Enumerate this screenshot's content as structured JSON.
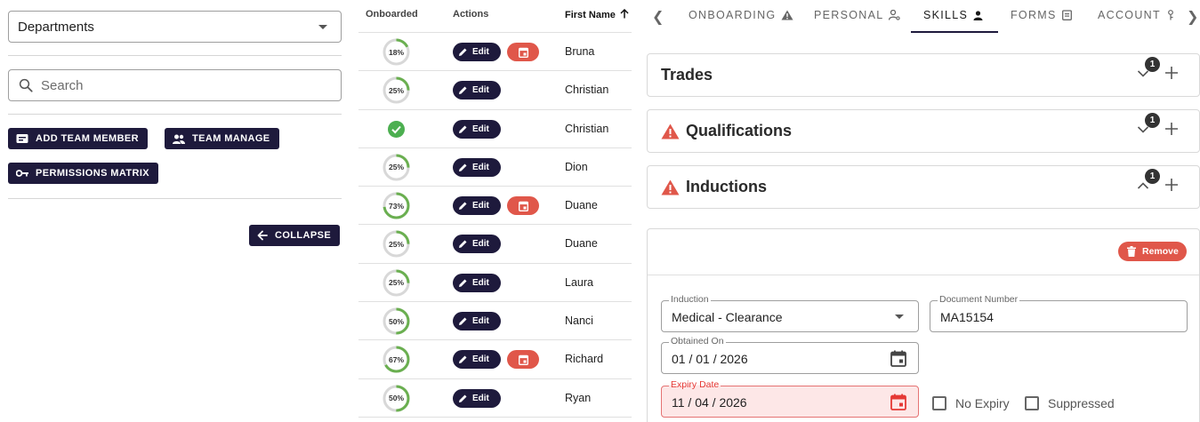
{
  "left": {
    "departments_value": "Departments",
    "search_placeholder": "Search",
    "buttons": {
      "add_team_member": "ADD TEAM MEMBER",
      "team_manage": "TEAM MANAGE",
      "permissions_matrix": "PERMISSIONS MATRIX",
      "collapse": "COLLAPSE"
    }
  },
  "table": {
    "headers": {
      "onboarded": "Onboarded",
      "actions": "Actions",
      "first_name": "First Name"
    },
    "edit_label": "Edit",
    "rows": [
      {
        "progress": 18,
        "label": "18%",
        "first_name": "Bruna",
        "calendar": true
      },
      {
        "progress": 25,
        "label": "25%",
        "first_name": "Christian",
        "calendar": false
      },
      {
        "progress": 100,
        "label": "",
        "first_name": "Christian",
        "calendar": false,
        "complete": true
      },
      {
        "progress": 25,
        "label": "25%",
        "first_name": "Dion",
        "calendar": false
      },
      {
        "progress": 73,
        "label": "73%",
        "first_name": "Duane",
        "calendar": true
      },
      {
        "progress": 25,
        "label": "25%",
        "first_name": "Duane",
        "calendar": false
      },
      {
        "progress": 25,
        "label": "25%",
        "first_name": "Laura",
        "calendar": false
      },
      {
        "progress": 50,
        "label": "50%",
        "first_name": "Nanci",
        "calendar": false
      },
      {
        "progress": 67,
        "label": "67%",
        "first_name": "Richard",
        "calendar": true
      },
      {
        "progress": 50,
        "label": "50%",
        "first_name": "Ryan",
        "calendar": false
      }
    ]
  },
  "tabs": {
    "onboarding": "ONBOARDING",
    "personal": "PERSONAL",
    "skills": "SKILLS",
    "forms": "FORMS",
    "account": "ACCOUNT"
  },
  "panels": {
    "trades": {
      "title": "Trades",
      "count": "1"
    },
    "qualifications": {
      "title": "Qualifications",
      "count": "1"
    },
    "inductions": {
      "title": "Inductions",
      "count": "1"
    }
  },
  "induction_form": {
    "remove_label": "Remove",
    "induction_label": "Induction",
    "induction_value": "Medical - Clearance",
    "document_number_label": "Document Number",
    "document_number_value": "MA15154",
    "obtained_on_label": "Obtained On",
    "obtained_on_value": "01 / 01 / 2026",
    "expiry_date_label": "Expiry Date",
    "expiry_date_value": "11 / 04 / 2026",
    "no_expiry_label": "No Expiry",
    "suppressed_label": "Suppressed"
  },
  "colors": {
    "primary_dark": "#1e1a3c",
    "danger": "#e0574a",
    "progress": "#6aaf50",
    "track": "#d8d8d8"
  }
}
